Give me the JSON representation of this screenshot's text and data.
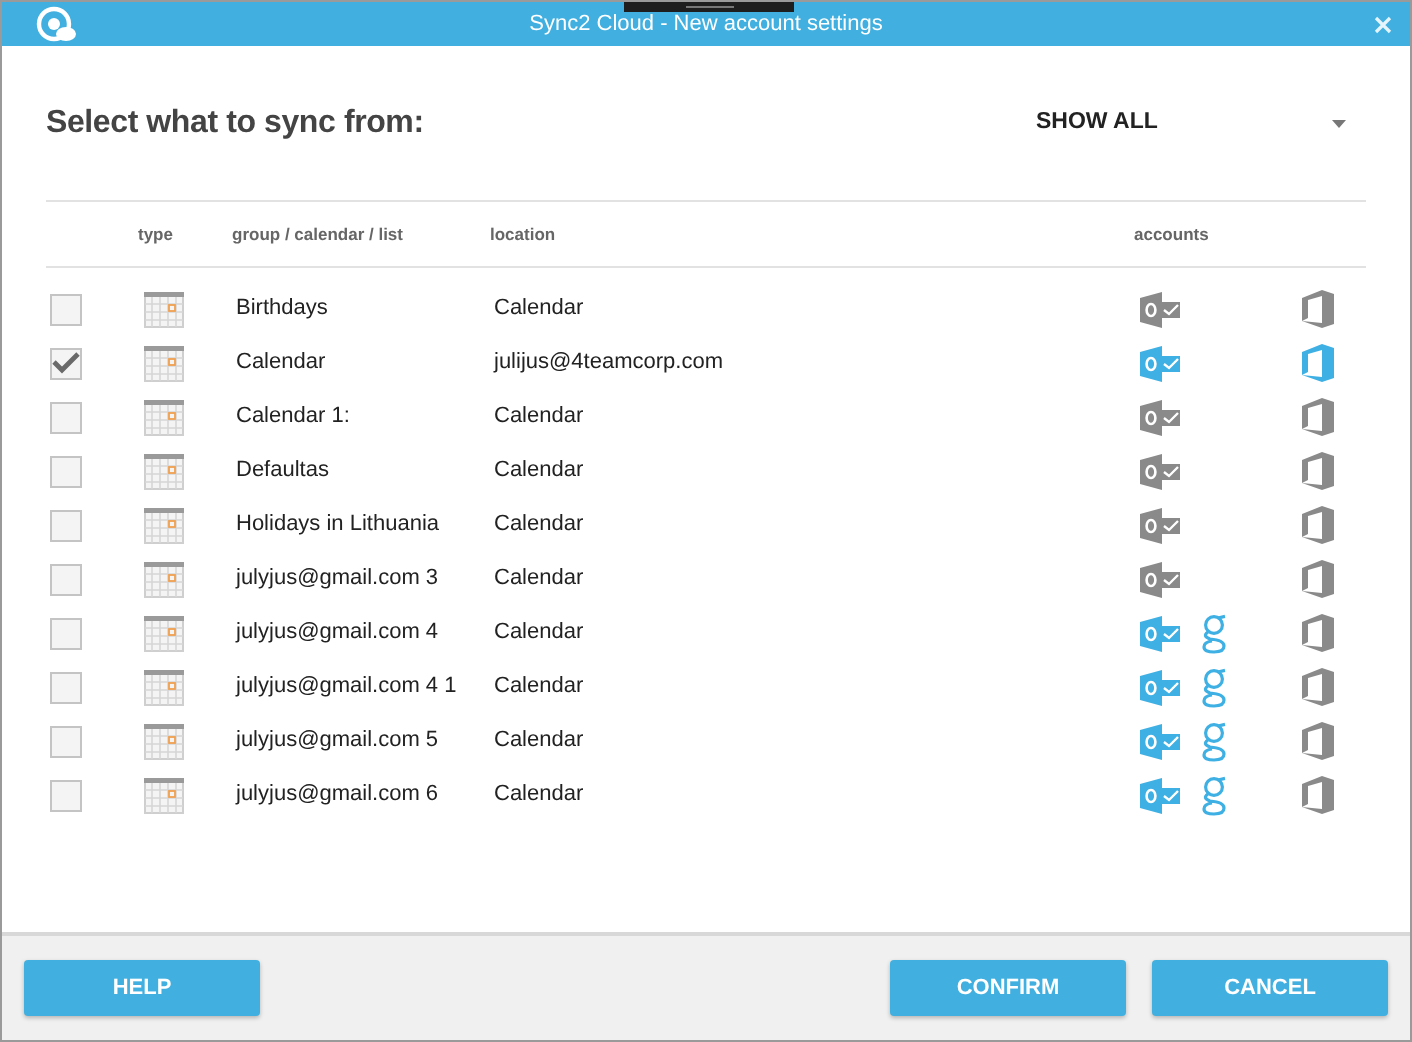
{
  "window": {
    "title": "Sync2 Cloud - New account settings"
  },
  "heading": "Select what to sync from:",
  "filter": {
    "value": "SHOW ALL"
  },
  "columns": {
    "type": "type",
    "name": "group / calendar / list",
    "location": "location",
    "accounts": "accounts"
  },
  "rows": [
    {
      "checked": false,
      "name": "Birthdays",
      "location": "Calendar",
      "outlook_active": false,
      "google": false,
      "office_active": false
    },
    {
      "checked": true,
      "name": "Calendar",
      "location": "julijus@4teamcorp.com",
      "outlook_active": true,
      "google": false,
      "office_active": true
    },
    {
      "checked": false,
      "name": "Calendar 1:",
      "location": "Calendar",
      "outlook_active": false,
      "google": false,
      "office_active": false
    },
    {
      "checked": false,
      "name": "Defaultas",
      "location": "Calendar",
      "outlook_active": false,
      "google": false,
      "office_active": false
    },
    {
      "checked": false,
      "name": "Holidays in Lithuania",
      "location": "Calendar",
      "outlook_active": false,
      "google": false,
      "office_active": false
    },
    {
      "checked": false,
      "name": "julyjus@gmail.com 3",
      "location": "Calendar",
      "outlook_active": false,
      "google": false,
      "office_active": false
    },
    {
      "checked": false,
      "name": "julyjus@gmail.com 4",
      "location": "Calendar",
      "outlook_active": true,
      "google": true,
      "office_active": false
    },
    {
      "checked": false,
      "name": "julyjus@gmail.com 4 1",
      "location": "Calendar",
      "outlook_active": true,
      "google": true,
      "office_active": false
    },
    {
      "checked": false,
      "name": "julyjus@gmail.com 5",
      "location": "Calendar",
      "outlook_active": true,
      "google": true,
      "office_active": false
    },
    {
      "checked": false,
      "name": "julyjus@gmail.com 6",
      "location": "Calendar",
      "outlook_active": true,
      "google": true,
      "office_active": false
    }
  ],
  "buttons": {
    "help": "HELP",
    "confirm": "CONFIRM",
    "cancel": "CANCEL"
  }
}
